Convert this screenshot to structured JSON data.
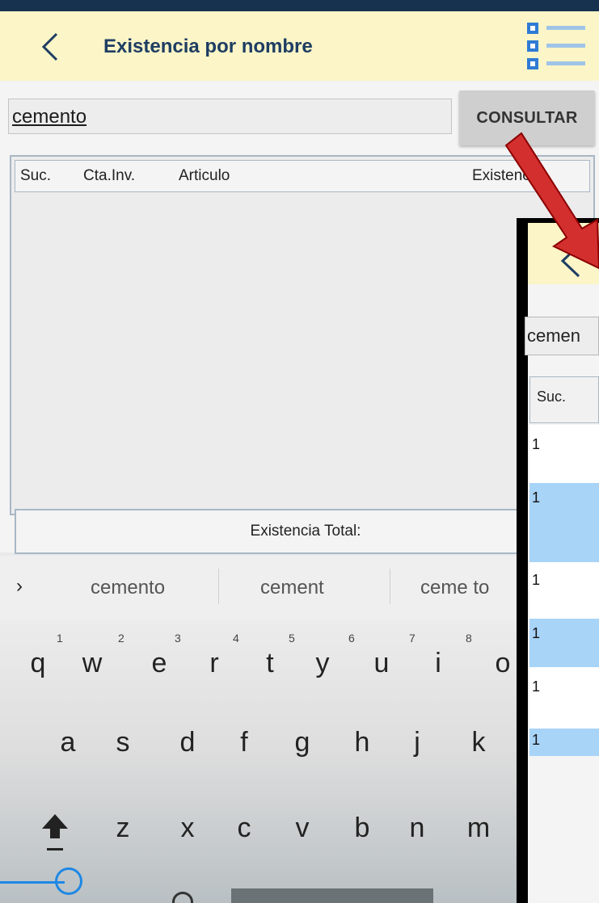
{
  "app": {
    "title": "Existencia por nombre",
    "accent_header": "#fbf5c7",
    "title_color": "#1e3d63"
  },
  "search": {
    "value": "cemento",
    "button_label": "CONSULTAR"
  },
  "table": {
    "columns": [
      "Suc.",
      "Cta.Inv.",
      "Articulo",
      "Existencia"
    ],
    "rows": []
  },
  "total": {
    "label": "Existencia Total:"
  },
  "keyboard": {
    "suggestions": [
      "cemento",
      "cement",
      "ceme to"
    ],
    "row1": [
      "q",
      "w",
      "e",
      "r",
      "t",
      "y",
      "u",
      "i",
      "o"
    ],
    "row1_hints": [
      "1",
      "2",
      "3",
      "4",
      "5",
      "6",
      "7",
      "8"
    ],
    "row2": [
      "a",
      "s",
      "d",
      "f",
      "g",
      "h",
      "j",
      "k"
    ],
    "row3": [
      "z",
      "x",
      "c",
      "v",
      "b",
      "n",
      "m"
    ]
  },
  "overlay": {
    "search_value": "cemen",
    "column": "Suc.",
    "rows": [
      {
        "value": "1",
        "highlight": false
      },
      {
        "value": "1",
        "highlight": true
      },
      {
        "value": "1",
        "highlight": false
      },
      {
        "value": "1",
        "highlight": true
      },
      {
        "value": "1",
        "highlight": false
      },
      {
        "value": "1",
        "highlight": true
      }
    ]
  },
  "annotation": {
    "arrow_color": "#d32f2f"
  }
}
